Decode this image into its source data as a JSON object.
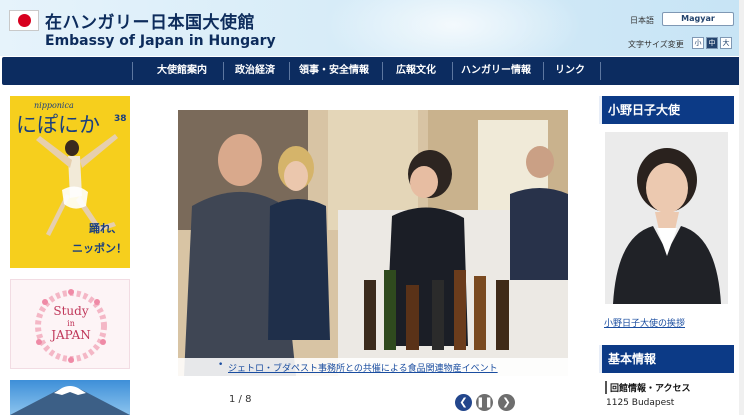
{
  "header": {
    "title_ja": "在ハンガリー日本国大使館",
    "title_en": "Embassy of Japan in Hungary",
    "lang_ja": "日本語",
    "lang_button": "Magyar",
    "font_size_label": "文字サイズ変更",
    "font_size_small": "小",
    "font_size_medium": "中",
    "font_size_large": "大"
  },
  "nav": {
    "items": [
      {
        "label": "大使館案内"
      },
      {
        "label": "政治経済"
      },
      {
        "label": "領事・安全情報"
      },
      {
        "label": "広報文化"
      },
      {
        "label": "ハンガリー情報"
      },
      {
        "label": "リンク"
      }
    ]
  },
  "left_banners": {
    "nipponica_en": "nipponica",
    "nipponica_ja": "にぽにか",
    "nipponica_issue": "38",
    "nipponica_caption_1": "踊れ、",
    "nipponica_caption_2": "ニッポン！",
    "study_line1": "Study",
    "study_line2": "in",
    "study_line3": "JAPAN"
  },
  "carousel": {
    "caption": "ジェトロ・ブダペスト事務所との共催による食品関連物産イベント",
    "page_indicator": "1 / 8"
  },
  "ambassador": {
    "heading": "小野日子大使",
    "link": "小野日子大使の挨拶"
  },
  "basic_info": {
    "heading": "基本情報",
    "item_title": "回館情報・アクセス",
    "address": "1125 Budapest"
  },
  "colors": {
    "navy": "#0c2c60",
    "heading_blue": "#0c3a86",
    "link_blue": "#1a4da0",
    "flag_red": "#d7001e",
    "banner_yellow": "#f6cf1d"
  }
}
